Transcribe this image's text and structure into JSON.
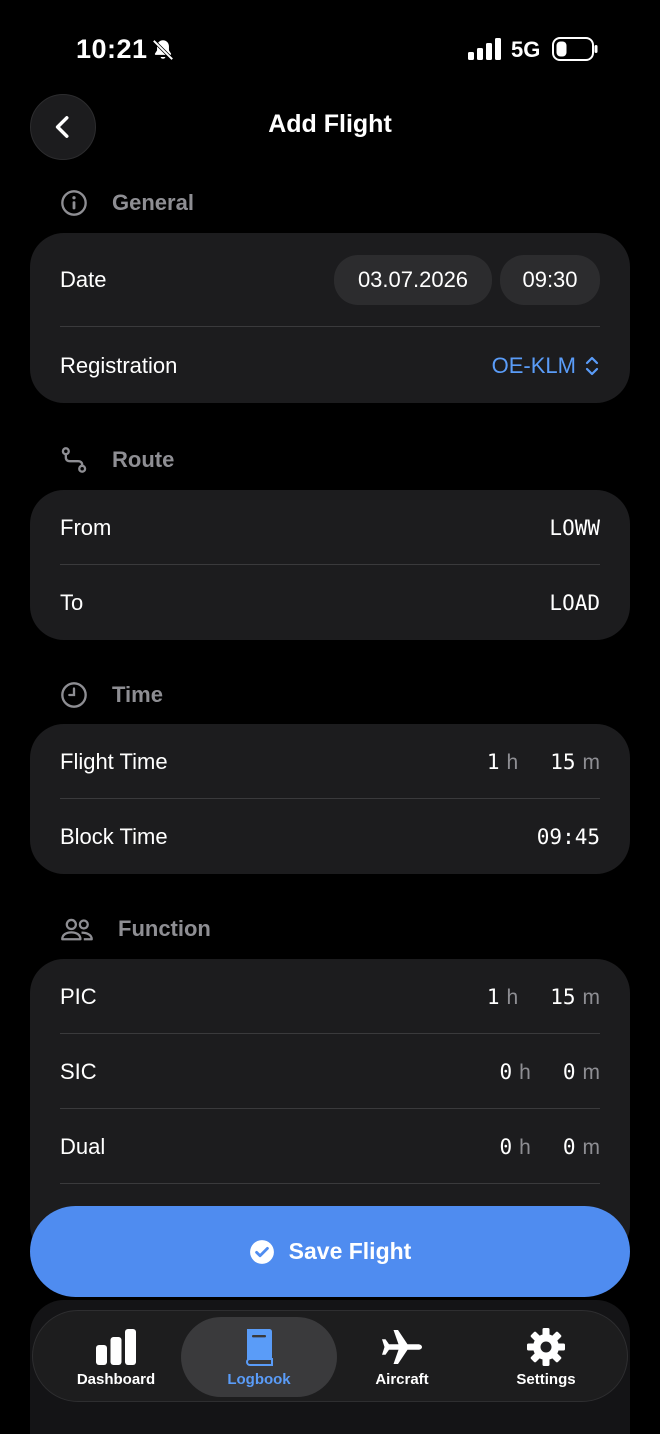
{
  "status_bar": {
    "time": "10:21",
    "network": "5G"
  },
  "header": {
    "title": "Add Flight"
  },
  "general": {
    "heading": "General",
    "date_label": "Date",
    "date_value": "03.07.2026",
    "time_value": "09:30",
    "registration_label": "Registration",
    "registration_value": "OE-KLM"
  },
  "route": {
    "heading": "Route",
    "from_label": "From",
    "from_value": "LOWW",
    "to_label": "To",
    "to_value": "LOAD"
  },
  "time": {
    "heading": "Time",
    "flight_time_label": "Flight Time",
    "flight_time_h": "1",
    "flight_time_m": "15",
    "block_time_label": "Block Time",
    "block_time_value": "09:45"
  },
  "function": {
    "heading": "Function",
    "rows": [
      {
        "label": "PIC",
        "h": "1",
        "m": "15"
      },
      {
        "label": "SIC",
        "h": "0",
        "m": "0"
      },
      {
        "label": "Dual",
        "h": "0",
        "m": "0"
      }
    ]
  },
  "units": {
    "hours": "h",
    "minutes": "m"
  },
  "save_button": {
    "label": "Save Flight"
  },
  "tabbar": {
    "items": [
      {
        "label": "Dashboard",
        "icon": "bar-chart-icon"
      },
      {
        "label": "Logbook",
        "icon": "book-icon"
      },
      {
        "label": "Aircraft",
        "icon": "airplane-icon"
      },
      {
        "label": "Settings",
        "icon": "gear-icon"
      }
    ],
    "active": "Logbook"
  },
  "colors": {
    "accent": "#4f8cf0",
    "card": "#1c1c1e",
    "background": "#000000"
  }
}
